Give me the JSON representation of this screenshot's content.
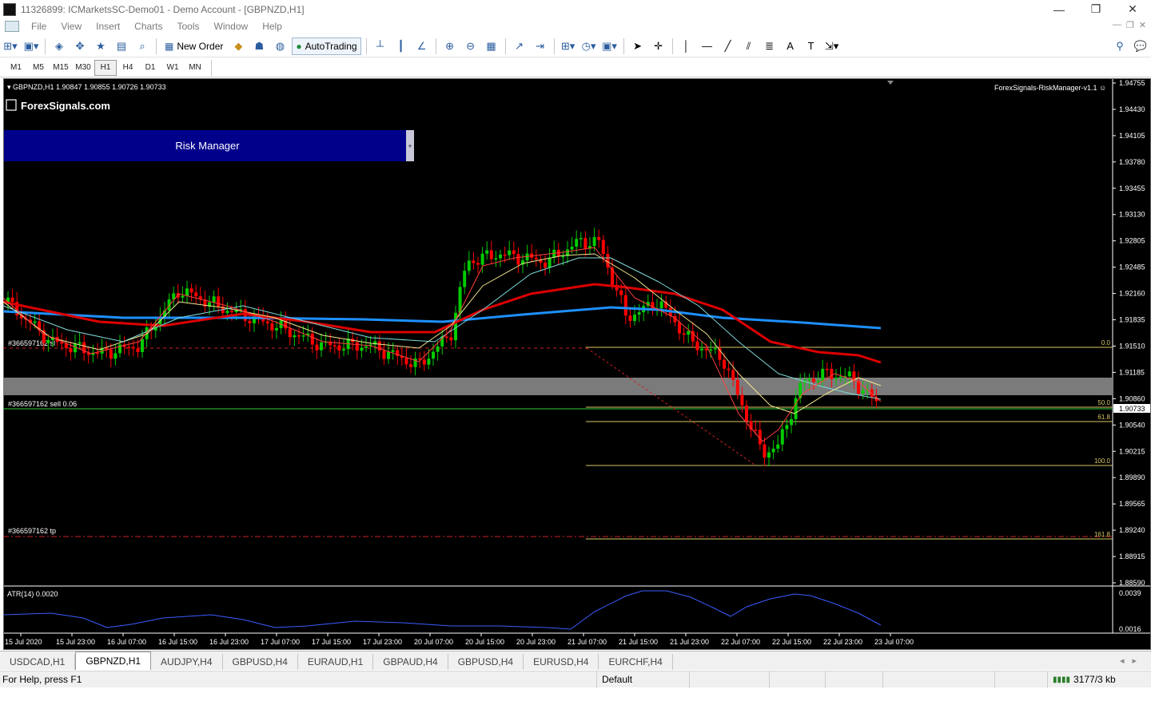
{
  "window": {
    "title": "11326899: ICMarketsSC-Demo01 - Demo Account - [GBPNZD,H1]",
    "controls": [
      "—",
      "❐",
      "✕"
    ]
  },
  "menu": [
    "File",
    "View",
    "Insert",
    "Charts",
    "Tools",
    "Window",
    "Help"
  ],
  "toolbar": {
    "new_order": "New Order",
    "autotrading": "AutoTrading"
  },
  "timeframes": [
    "M1",
    "M5",
    "M15",
    "M30",
    "H1",
    "H4",
    "D1",
    "W1",
    "MN"
  ],
  "active_timeframe": "H1",
  "chart": {
    "header": "GBPNZD,H1  1.90847 1.90855 1.90726 1.90733",
    "indicator_label": "ForexSignals-RiskManager-v1.1",
    "logo": "ForexSignals.com",
    "risk_manager_label": "Risk Manager",
    "risk_handle": "+",
    "price_axis": [
      "1.94755",
      "1.94430",
      "1.94105",
      "1.93780",
      "1.93455",
      "1.93130",
      "1.92805",
      "1.92485",
      "1.92160",
      "1.91835",
      "1.91510",
      "1.91185",
      "1.90860",
      "1.90540",
      "1.90215",
      "1.89890",
      "1.89565",
      "1.89240",
      "1.88915",
      "1.88590"
    ],
    "current_price": "1.90733",
    "order_labels": {
      "sl": "#366597162 sl",
      "sell": "#366597162 sell 0.06",
      "tp": "#366597162 tp"
    },
    "fib_levels": [
      "0.0",
      "50.0",
      "61.8",
      "100.0",
      "161.8"
    ],
    "atr_label": "ATR(14) 0.0020",
    "atr_axis": [
      "0.0039",
      "0.0016"
    ],
    "time_axis": [
      "15 Jul 2020",
      "15 Jul 23:00",
      "16 Jul 07:00",
      "16 Jul 15:00",
      "16 Jul 23:00",
      "17 Jul 07:00",
      "17 Jul 15:00",
      "17 Jul 23:00",
      "20 Jul 07:00",
      "20 Jul 15:00",
      "20 Jul 23:00",
      "21 Jul 07:00",
      "21 Jul 15:00",
      "21 Jul 23:00",
      "22 Jul 07:00",
      "22 Jul 15:00",
      "22 Jul 23:00",
      "23 Jul 07:00"
    ],
    "colors": {
      "bull": "#00cc00",
      "bear": "#ff0000",
      "ma_slow": "#1e90ff",
      "ma_mid": "#dc0000",
      "ma_fast1": "#f0e68c",
      "ma_fast2": "#7fd8d8",
      "ma_fast3": "#ff4040",
      "fib": "#d8c864",
      "atr": "#3a5bff"
    }
  },
  "tabs": [
    "USDCAD,H1",
    "GBPNZD,H1",
    "AUDJPY,H4",
    "GBPUSD,H4",
    "EURAUD,H1",
    "GBPAUD,H4",
    "GBPUSD,H4",
    "EURUSD,H4",
    "EURCHF,H4"
  ],
  "active_tab": "GBPNZD,H1",
  "status": {
    "help": "For Help, press F1",
    "profile": "Default",
    "traffic": "3177/3 kb"
  }
}
